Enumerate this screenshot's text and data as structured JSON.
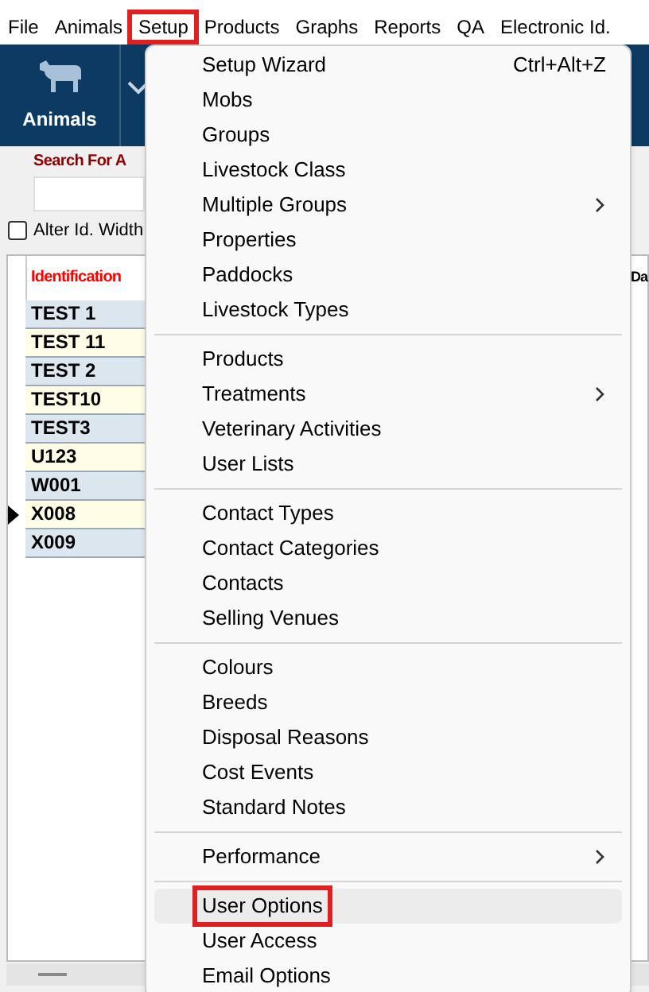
{
  "menubar": [
    {
      "label": "File",
      "open": false
    },
    {
      "label": "Animals",
      "open": false
    },
    {
      "label": "Setup",
      "open": true
    },
    {
      "label": "Products",
      "open": false
    },
    {
      "label": "Graphs",
      "open": false
    },
    {
      "label": "Reports",
      "open": false
    },
    {
      "label": "QA",
      "open": false
    },
    {
      "label": "Electronic Id.",
      "open": false
    }
  ],
  "toolbar": {
    "animals_button": "Animals"
  },
  "search": {
    "label": "Search For A"
  },
  "alter_id_width": {
    "label": "Alter Id. Width",
    "checked": false
  },
  "grid": {
    "columns": [
      "Identification",
      "Da"
    ],
    "rows": [
      {
        "id": "TEST 1",
        "current": false
      },
      {
        "id": "TEST 11",
        "current": false
      },
      {
        "id": "TEST 2",
        "current": false
      },
      {
        "id": "TEST10",
        "current": false
      },
      {
        "id": "TEST3",
        "current": false
      },
      {
        "id": "U123",
        "current": false
      },
      {
        "id": "W001",
        "current": false
      },
      {
        "id": "X008",
        "current": true
      },
      {
        "id": "X009",
        "current": false
      }
    ]
  },
  "setup_menu": [
    [
      {
        "label": "Setup Wizard",
        "shortcut": "Ctrl+Alt+Z",
        "submenu": false,
        "selected": false
      },
      {
        "label": "Mobs",
        "submenu": false,
        "selected": false
      },
      {
        "label": "Groups",
        "submenu": false,
        "selected": false
      },
      {
        "label": "Livestock Class",
        "submenu": false,
        "selected": false
      },
      {
        "label": "Multiple Groups",
        "submenu": true,
        "selected": false
      },
      {
        "label": "Properties",
        "submenu": false,
        "selected": false
      },
      {
        "label": "Paddocks",
        "submenu": false,
        "selected": false
      },
      {
        "label": "Livestock Types",
        "submenu": false,
        "selected": false
      }
    ],
    [
      {
        "label": "Products",
        "submenu": false,
        "selected": false
      },
      {
        "label": "Treatments",
        "submenu": true,
        "selected": false
      },
      {
        "label": "Veterinary Activities",
        "submenu": false,
        "selected": false
      },
      {
        "label": "User Lists",
        "submenu": false,
        "selected": false
      }
    ],
    [
      {
        "label": "Contact Types",
        "submenu": false,
        "selected": false
      },
      {
        "label": "Contact Categories",
        "submenu": false,
        "selected": false
      },
      {
        "label": "Contacts",
        "submenu": false,
        "selected": false
      },
      {
        "label": "Selling Venues",
        "submenu": false,
        "selected": false
      }
    ],
    [
      {
        "label": "Colours",
        "submenu": false,
        "selected": false
      },
      {
        "label": "Breeds",
        "submenu": false,
        "selected": false
      },
      {
        "label": "Disposal Reasons",
        "submenu": false,
        "selected": false
      },
      {
        "label": "Cost Events",
        "submenu": false,
        "selected": false
      },
      {
        "label": "Standard Notes",
        "submenu": false,
        "selected": false
      }
    ],
    [
      {
        "label": "Performance",
        "submenu": true,
        "selected": false
      }
    ],
    [
      {
        "label": "User Options",
        "submenu": false,
        "selected": true
      },
      {
        "label": "User Access",
        "submenu": false,
        "selected": false
      },
      {
        "label": "Email Options",
        "submenu": false,
        "selected": false
      }
    ]
  ]
}
